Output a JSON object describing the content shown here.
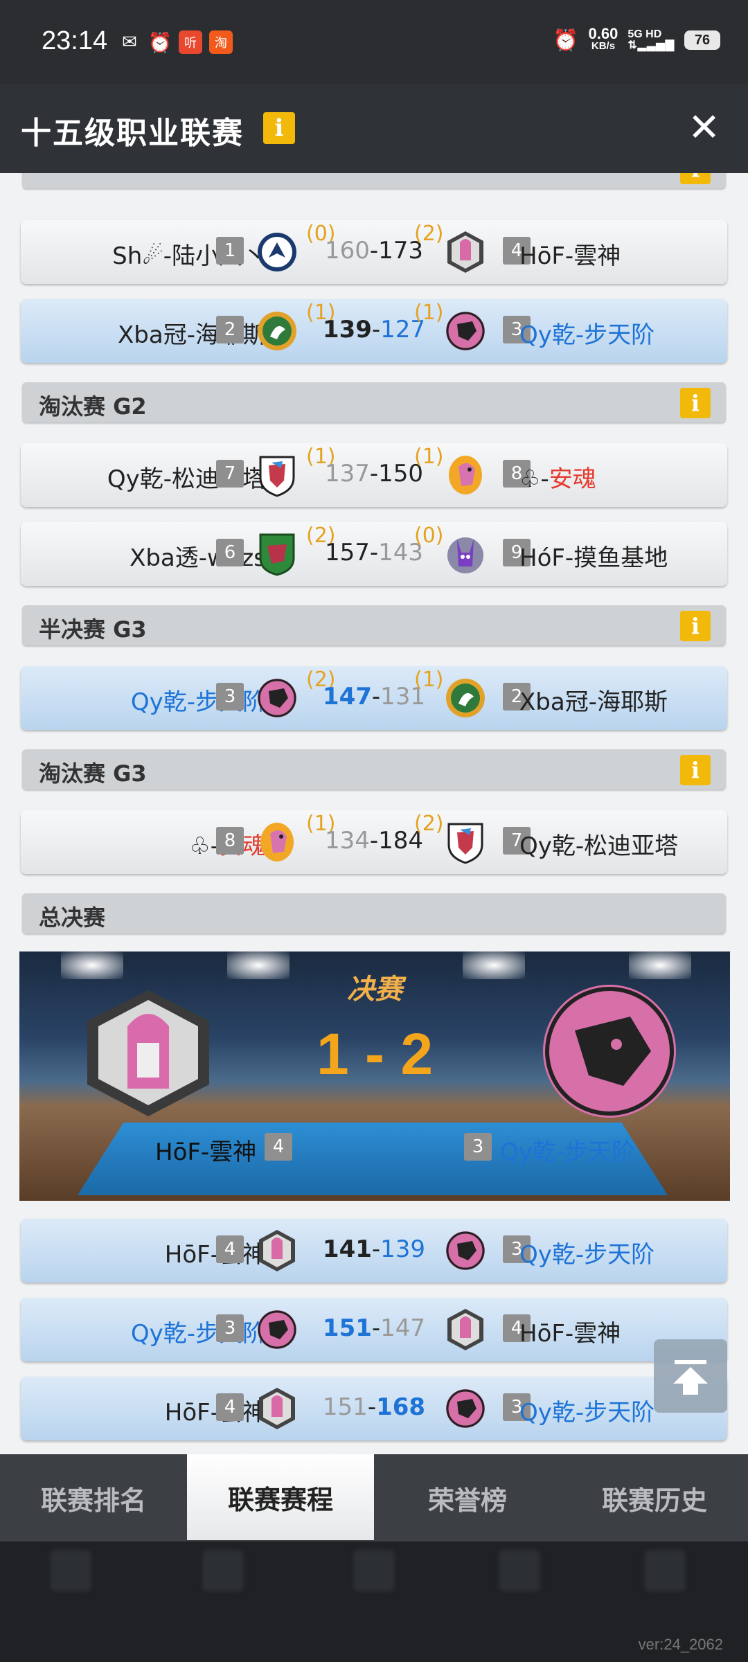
{
  "status_bar": {
    "time": "23:14",
    "net_speed_value": "0.60",
    "net_speed_unit": "KB/s",
    "signal": "5G HD",
    "battery": "76"
  },
  "header": {
    "title": "十五级职业联赛",
    "info_icon": "i"
  },
  "sections": {
    "elim_g2": "淘汰赛 G2",
    "semi_g3": "半决赛 G3",
    "elim_g3": "淘汰赛 G3",
    "final": "总决赛"
  },
  "matches": [
    {
      "left_name": "Sh☄-陆小凤丶",
      "left_seed": "1",
      "left_wins": "(0)",
      "left_score": "160",
      "right_score": "173",
      "right_wins": "(2)",
      "right_seed": "4",
      "right_name": "HōF-雲神"
    },
    {
      "left_name": "Xba冠-海耶斯",
      "left_seed": "2",
      "left_wins": "(1)",
      "left_score": "139",
      "right_score": "127",
      "right_wins": "(1)",
      "right_seed": "3",
      "right_name": "Qy乾-步天阶"
    },
    {
      "left_name": "Qy乾-松迪亚塔",
      "left_seed": "7",
      "left_wins": "(1)",
      "left_score": "137",
      "right_score": "150",
      "right_wins": "(1)",
      "right_seed": "8",
      "right_name_prefix": "♧-",
      "right_name": "安魂"
    },
    {
      "left_name": "Xba透-wdzs",
      "left_seed": "6",
      "left_wins": "(2)",
      "left_score": "157",
      "right_score": "143",
      "right_wins": "(0)",
      "right_seed": "9",
      "right_name": "HóF-摸鱼基地"
    },
    {
      "left_name": "Qy乾-步天阶",
      "left_seed": "3",
      "left_wins": "(2)",
      "left_score": "147",
      "right_score": "131",
      "right_wins": "(1)",
      "right_seed": "2",
      "right_name": "Xba冠-海耶斯"
    },
    {
      "left_name_prefix": "♧-",
      "left_name": "安魂",
      "left_seed": "8",
      "left_wins": "(1)",
      "left_score": "134",
      "right_score": "184",
      "right_wins": "(2)",
      "right_seed": "7",
      "right_name": "Qy乾-松迪亚塔"
    },
    {
      "left_name": "HōF-雲神",
      "left_seed": "4",
      "left_score": "141",
      "right_score": "139",
      "right_seed": "3",
      "right_name": "Qy乾-步天阶"
    },
    {
      "left_name": "Qy乾-步天阶",
      "left_seed": "3",
      "left_score": "151",
      "right_score": "147",
      "right_seed": "4",
      "right_name": "HōF-雲神"
    },
    {
      "left_name": "HōF-雲神",
      "left_seed": "4",
      "left_score": "151",
      "right_score": "168",
      "right_seed": "3",
      "right_name": "Qy乾-步天阶"
    }
  ],
  "finals": {
    "title": "决赛",
    "series_score": "1 - 2",
    "left_name": "HōF-雲神",
    "left_seed": "4",
    "right_seed": "3",
    "right_name": "Qy乾-步天阶"
  },
  "tabs": [
    "联赛排名",
    "联赛赛程",
    "荣誉榜",
    "联赛历史"
  ],
  "version": "ver:24_2062",
  "colors": {
    "accent_blue": "#1e73d6",
    "trophy_yellow": "#f2b90b",
    "wins_orange": "#e5a21f",
    "name_red": "#e53a2e"
  }
}
